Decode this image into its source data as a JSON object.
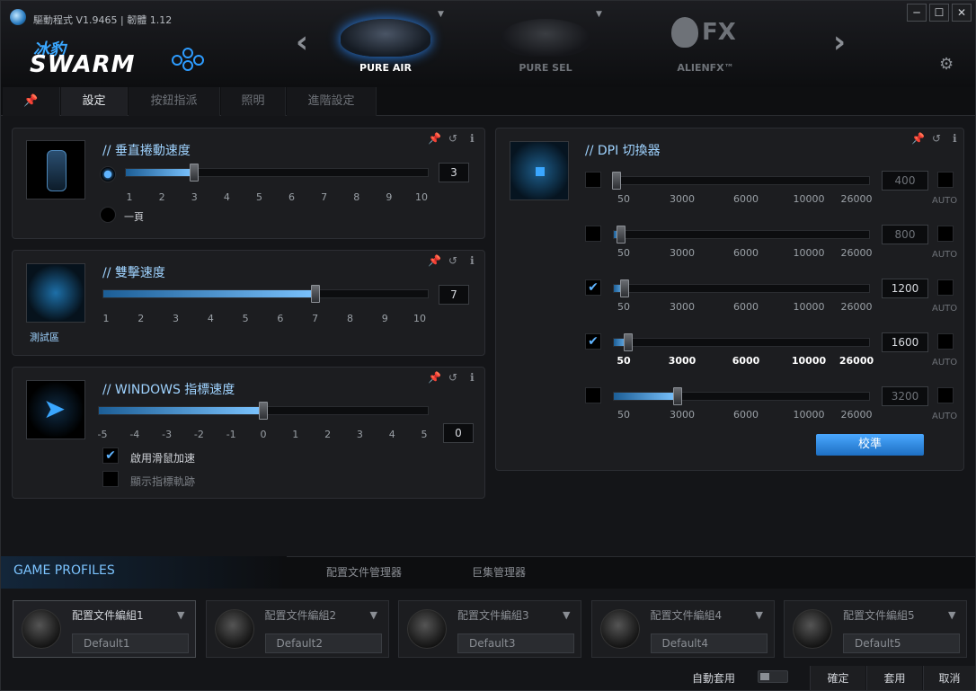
{
  "window": {
    "version": "驅動程式 V1.9465 | 韌體 1.12",
    "controls": [
      "─",
      "☐",
      "✕"
    ]
  },
  "logo": {
    "cn": "冰豹",
    "name": "SWARM"
  },
  "products": [
    {
      "name": "PURE AIR",
      "active": true
    },
    {
      "name": "PURE SEL",
      "active": false
    },
    {
      "name": "ALIENFX™",
      "active": false
    }
  ],
  "alienfx_logo": "FX",
  "tabs": [
    "設定",
    "按鈕指派",
    "照明",
    "進階設定"
  ],
  "scroll": {
    "title": "// 垂直捲動速度",
    "ticks": [
      "1",
      "2",
      "3",
      "4",
      "5",
      "6",
      "7",
      "8",
      "9",
      "10"
    ],
    "value": "3",
    "level": 3,
    "page_label": "一頁"
  },
  "dblclick": {
    "title": "// 雙擊速度",
    "ticks": [
      "1",
      "2",
      "3",
      "4",
      "5",
      "6",
      "7",
      "8",
      "9",
      "10"
    ],
    "value": "7",
    "level": 7,
    "test_area": "測試區"
  },
  "pointer": {
    "title": "// WINDOWS 指標速度",
    "ticks": [
      "-5",
      "-4",
      "-3",
      "-2",
      "-1",
      "0",
      "1",
      "2",
      "3",
      "4",
      "5"
    ],
    "value": "0",
    "level": 0,
    "accel_label": "啟用滑鼠加速",
    "trail_label": "顯示指標軌跡"
  },
  "dpi": {
    "title": "// DPI 切換器",
    "ticks": [
      "50",
      "3000",
      "6000",
      "10000",
      "26000"
    ],
    "auto_label": "AUTO",
    "rows": [
      {
        "value": "400",
        "enabled": false,
        "fraction": 0.015
      },
      {
        "value": "800",
        "enabled": false,
        "fraction": 0.03
      },
      {
        "value": "1200",
        "enabled": true,
        "fraction": 0.045
      },
      {
        "value": "1600",
        "enabled": true,
        "fraction": 0.06
      },
      {
        "value": "3200",
        "enabled": false,
        "fraction": 0.25
      }
    ],
    "calibrate": "校準"
  },
  "bottom": {
    "title": "GAME PROFILES",
    "tabs": [
      "配置文件管理器",
      "巨集管理器"
    ],
    "profiles": [
      {
        "name": "配置文件編組1",
        "field": "Default1"
      },
      {
        "name": "配置文件編組2",
        "field": "Default2"
      },
      {
        "name": "配置文件編組3",
        "field": "Default3"
      },
      {
        "name": "配置文件編組4",
        "field": "Default4"
      },
      {
        "name": "配置文件編組5",
        "field": "Default5"
      }
    ],
    "auto_apply": "自動套用",
    "buttons": [
      "確定",
      "套用",
      "取消"
    ]
  },
  "colors": {
    "accent": "#3aa7ff",
    "bg": "#141518",
    "panel": "#1c1d20"
  }
}
